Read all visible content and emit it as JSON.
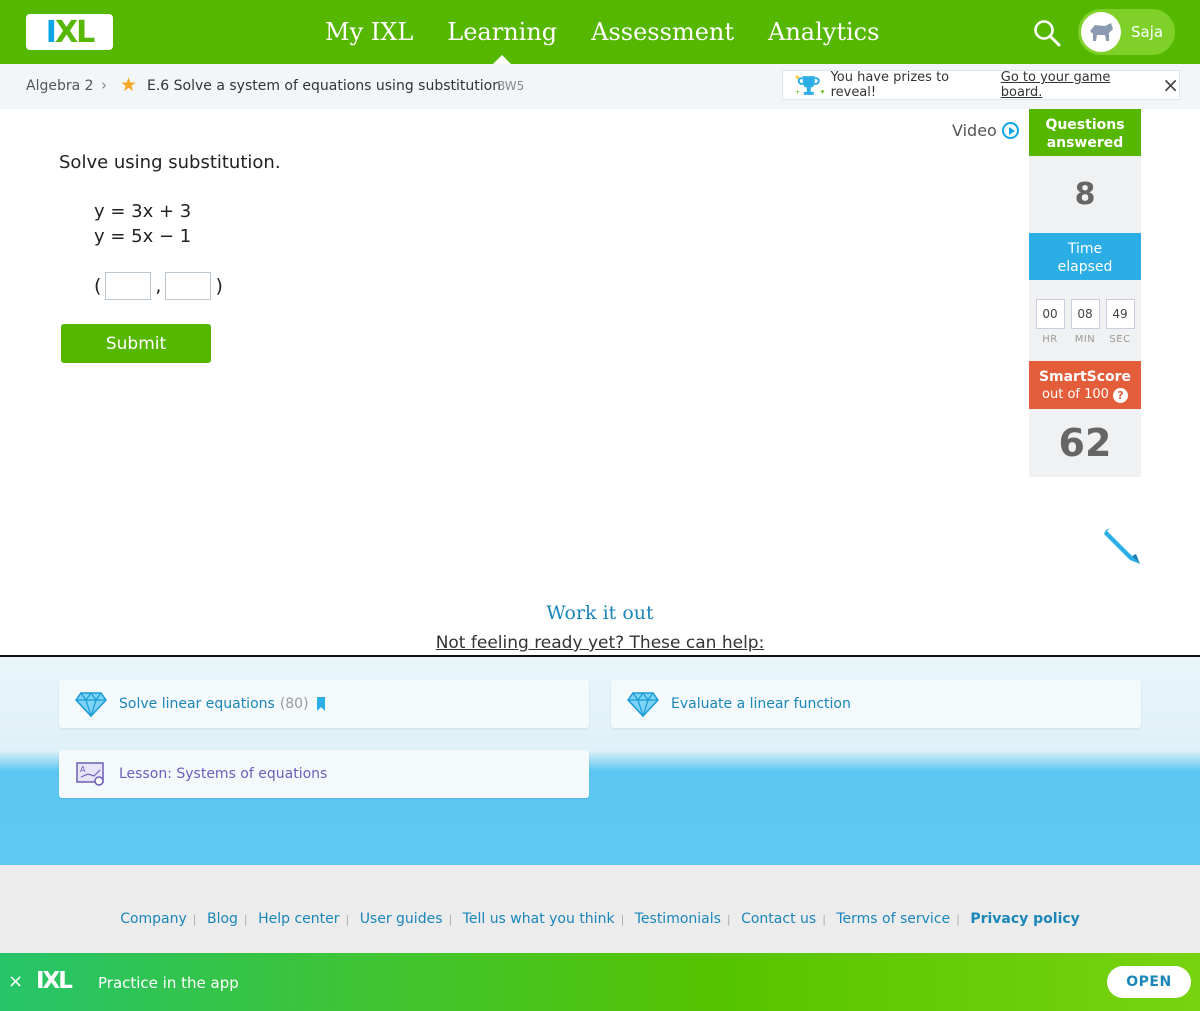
{
  "header": {
    "logo_text": "IXL",
    "nav": [
      "My IXL",
      "Learning",
      "Assessment",
      "Analytics"
    ],
    "active_nav": "Learning",
    "user_name": "Saja"
  },
  "breadcrumb": {
    "course": "Algebra 2",
    "skill": "E.6 Solve a system of equations using substitution",
    "skill_code": "BW5"
  },
  "prize": {
    "text": "You have prizes to reveal!",
    "link": "Go to your game board."
  },
  "question": {
    "video_label": "Video",
    "prompt": "Solve using substitution.",
    "equation1": "y = 3x + 3",
    "equation2": "y = 5x − 1",
    "open_paren": "(",
    "comma": ",",
    "close_paren": ")",
    "answer_x": "",
    "answer_y": "",
    "submit_label": "Submit"
  },
  "stats": {
    "questions_label_1": "Questions",
    "questions_label_2": "answered",
    "questions_value": "8",
    "time_label_1": "Time",
    "time_label_2": "elapsed",
    "hr": "00",
    "min": "08",
    "sec": "49",
    "hr_label": "HR",
    "min_label": "MIN",
    "sec_label": "SEC",
    "smartscore_label": "SmartScore",
    "smartscore_sub": "out of 100",
    "smartscore_help": "?",
    "smartscore_value": "62"
  },
  "help": {
    "work_it_out": "Work it out",
    "not_ready": "Not feeling ready yet? These can help:",
    "cards": [
      {
        "label": "Solve linear equations",
        "count": "(80)"
      },
      {
        "label": "Evaluate a linear function"
      },
      {
        "label": "Lesson: Systems of equations"
      }
    ]
  },
  "footer": {
    "links": [
      "Company",
      "Blog",
      "Help center",
      "User guides",
      "Tell us what you think",
      "Testimonials",
      "Contact us",
      "Terms of service",
      "Privacy policy"
    ]
  },
  "appbar": {
    "close": "×",
    "logo": "IXL",
    "text": "Practice in the app",
    "open_label": "OPEN"
  },
  "colors": {
    "brand_green": "#56b700",
    "brand_blue": "#2bade6",
    "smartscore_orange": "#e45d3a",
    "link_blue": "#1a86b9"
  },
  "icons": [
    "search-icon",
    "avatar-icon",
    "star-icon",
    "trophy-icon",
    "close-icon",
    "play-icon",
    "help-icon",
    "pencil-icon",
    "diamond-icon",
    "bookmark-icon",
    "lesson-icon"
  ]
}
